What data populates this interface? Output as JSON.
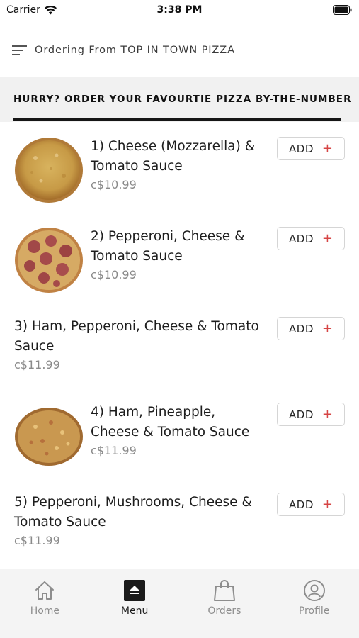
{
  "status_bar": {
    "carrier": "Carrier",
    "time": "3:38 PM"
  },
  "header": {
    "title": "Ordering From TOP IN TOWN PIZZA"
  },
  "banner": {
    "text": "HURRY? ORDER YOUR FAVOURTIE PIZZA BY-THE-NUMBER"
  },
  "menu": {
    "add_label": "ADD",
    "add_icon": "+",
    "items": [
      {
        "name": "1) Cheese (Mozzarella) & Tomato Sauce",
        "price": "c$10.99",
        "image": "cheese-pizza-image"
      },
      {
        "name": "2) Pepperoni, Cheese & Tomato Sauce",
        "price": "c$10.99",
        "image": "pepperoni-pizza-image"
      },
      {
        "name": "3) Ham, Pepperoni, Cheese & Tomato Sauce",
        "price": "c$11.99",
        "image": ""
      },
      {
        "name": "4) Ham, Pineapple, Cheese & Tomato Sauce",
        "price": "c$11.99",
        "image": "hawaiian-pizza-image"
      },
      {
        "name": "5) Pepperoni, Mushrooms, Cheese & Tomato Sauce",
        "price": "c$11.99",
        "image": ""
      }
    ]
  },
  "tabs": [
    {
      "label": "Home",
      "icon": "home-icon",
      "active": false
    },
    {
      "label": "Menu",
      "icon": "menu-icon",
      "active": true
    },
    {
      "label": "Orders",
      "icon": "shopping-bag-icon",
      "active": false
    },
    {
      "label": "Profile",
      "icon": "profile-icon",
      "active": false
    }
  ],
  "colors": {
    "accent_plus": "#d64545",
    "active_tab": "#1b1b1b",
    "inactive_tab": "#8d8d8d",
    "banner_bg": "#f1f1f1"
  }
}
